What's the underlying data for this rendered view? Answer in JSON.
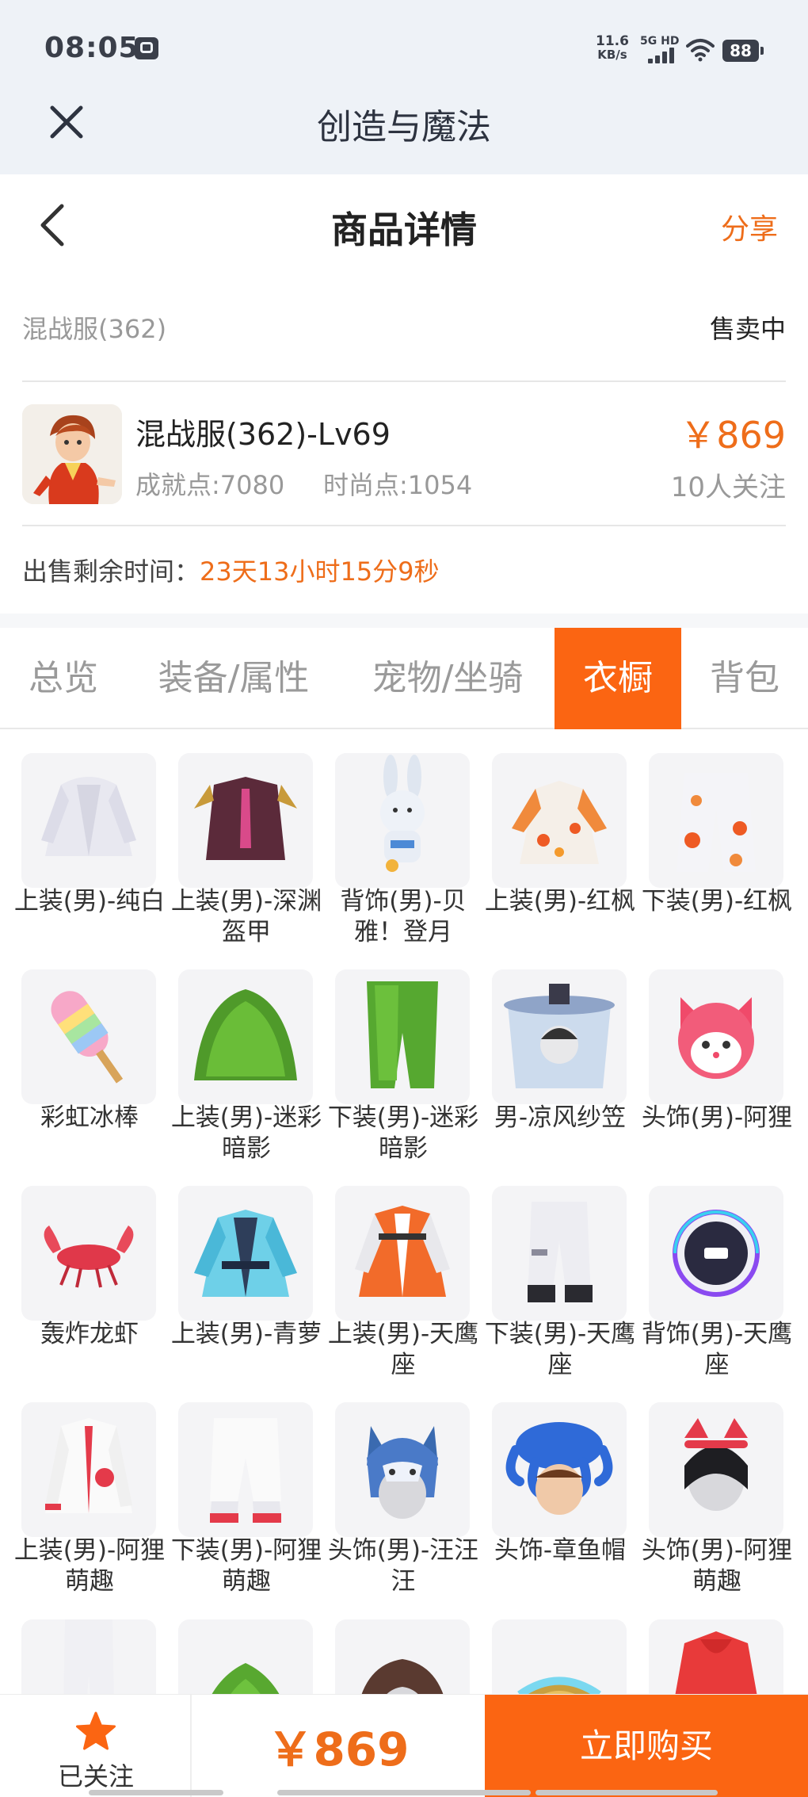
{
  "status": {
    "time": "08:05",
    "net_speed_value": "11.6",
    "net_speed_unit": "KB/s",
    "network": "5G HD",
    "battery": "88"
  },
  "app": {
    "title": "创造与魔法"
  },
  "page": {
    "title": "商品详情",
    "share_label": "分享"
  },
  "server": {
    "name": "混战服(362)",
    "status": "售卖中"
  },
  "product": {
    "name": "混战服(362)-Lv69",
    "achievement": "成就点:7080",
    "fashion": "时尚点:1054",
    "price": "￥869",
    "followers": "10人关注"
  },
  "remaining": {
    "label": "出售剩余时间：",
    "value": "23天13小时15分9秒"
  },
  "tabs": [
    {
      "label": "总览",
      "active": false
    },
    {
      "label": "装备/属性",
      "active": false
    },
    {
      "label": "宠物/坐骑",
      "active": false
    },
    {
      "label": "衣橱",
      "active": true
    },
    {
      "label": "背包",
      "active": false
    }
  ],
  "wardrobe": [
    {
      "label": "上装(男)-纯白",
      "icon": "white-coat-icon"
    },
    {
      "label": "上装(男)-深渊盔甲",
      "icon": "abyss-armor-icon"
    },
    {
      "label": "背饰(男)-贝雅！登月",
      "icon": "bunny-astronaut-icon"
    },
    {
      "label": "上装(男)-红枫",
      "icon": "maple-robe-icon"
    },
    {
      "label": "下装(男)-红枫",
      "icon": "maple-pants-icon"
    },
    {
      "label": "彩虹冰棒",
      "icon": "rainbow-popsicle-icon"
    },
    {
      "label": "上装(男)-迷彩暗影",
      "icon": "ghillie-top-icon"
    },
    {
      "label": "下装(男)-迷彩暗影",
      "icon": "ghillie-pants-icon"
    },
    {
      "label": "男-凉风纱笠",
      "icon": "veil-hat-icon"
    },
    {
      "label": "头饰(男)-阿狸",
      "icon": "ali-fox-head-icon"
    },
    {
      "label": "轰炸龙虾",
      "icon": "lobster-icon"
    },
    {
      "label": "上装(男)-青萝",
      "icon": "teal-coat-icon"
    },
    {
      "label": "上装(男)-天鹰座",
      "icon": "aquila-jacket-icon"
    },
    {
      "label": "下装(男)-天鹰座",
      "icon": "aquila-pants-icon"
    },
    {
      "label": "背饰(男)-天鹰座",
      "icon": "aquila-backpack-icon"
    },
    {
      "label": "上装(男)-阿狸萌趣",
      "icon": "ali-hoodie-icon"
    },
    {
      "label": "下装(男)-阿狸萌趣",
      "icon": "ali-pants-icon"
    },
    {
      "label": "头饰(男)-汪汪汪",
      "icon": "husky-hat-icon"
    },
    {
      "label": "头饰-章鱼帽",
      "icon": "octopus-hat-icon"
    },
    {
      "label": "头饰(男)-阿狸萌趣",
      "icon": "ali-headband-icon"
    },
    {
      "label": "",
      "icon": "white-pants-icon"
    },
    {
      "label": "",
      "icon": "ghillie-partial-icon"
    },
    {
      "label": "",
      "icon": "brown-hair-icon"
    },
    {
      "label": "",
      "icon": "gold-helmet-icon"
    },
    {
      "label": "",
      "icon": "red-hoodie-icon"
    }
  ],
  "bottom": {
    "follow_label": "已关注",
    "price": "￥869",
    "buy_label": "立即购买"
  },
  "colors": {
    "accent": "#fb6512",
    "price": "#ee6d1a"
  }
}
